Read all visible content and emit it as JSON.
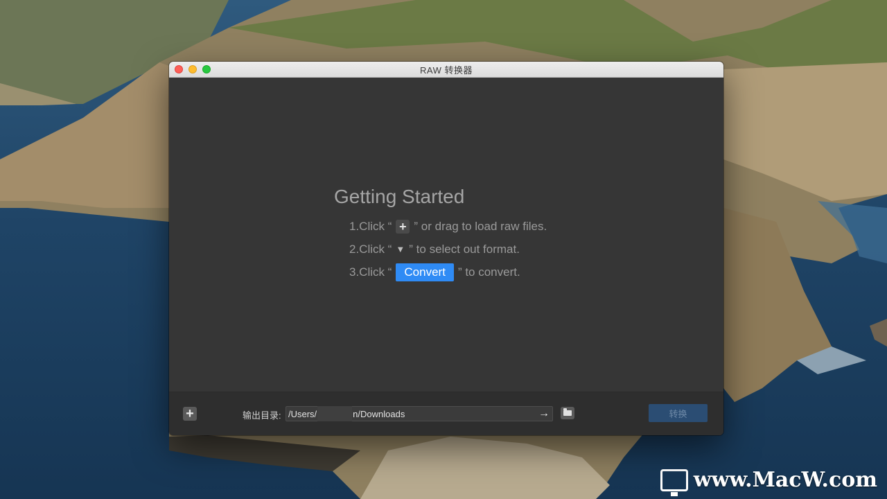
{
  "window": {
    "title": "RAW 转换器"
  },
  "guide": {
    "title": "Getting Started",
    "step1_prefix": "1.Click “",
    "step1_suffix": "” or drag to load raw files.",
    "step2_prefix": "2.Click “",
    "step2_suffix": "” to select out format.",
    "step3_prefix": "3.Click “",
    "step3_button": "Convert",
    "step3_suffix": "” to convert.",
    "plus_glyph": "+",
    "triangle_glyph": "▼"
  },
  "footer": {
    "add_glyph": "+",
    "output_label": "输出目录:",
    "path_start": "/Users/",
    "path_end": "n/Downloads",
    "arrow_glyph": "→",
    "convert_label": "转换"
  },
  "watermark": {
    "text": "www.MacW.com"
  },
  "icons": {
    "add": "plus-icon",
    "format": "triangle-down-icon",
    "go": "arrow-right-icon",
    "folder": "folder-icon",
    "logo": "macw-monitor-logo"
  },
  "colors": {
    "accent": "#2f8bf5",
    "window_bg": "#363636",
    "footer_bg": "#2e2e2e",
    "convert_disabled": "#2b4d73"
  }
}
